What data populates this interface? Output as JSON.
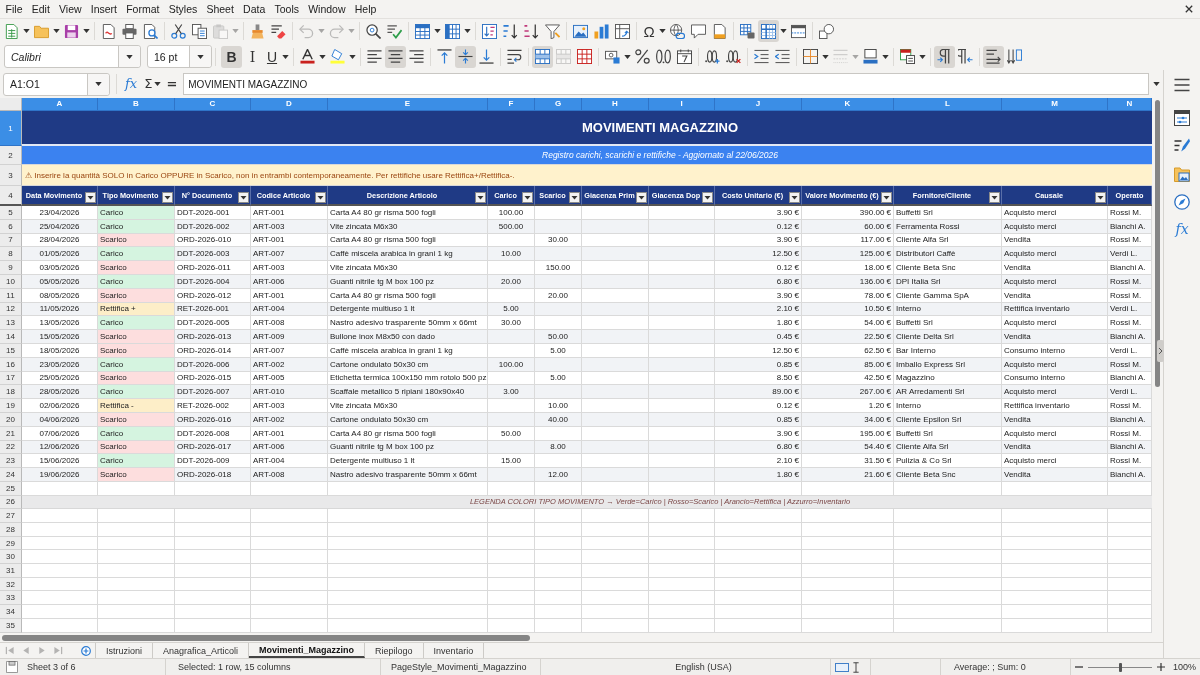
{
  "menu_bar": [
    "File",
    "Edit",
    "View",
    "Insert",
    "Format",
    "Styles",
    "Sheet",
    "Data",
    "Tools",
    "Window",
    "Help"
  ],
  "standard_toolbar": {
    "paste_enabled": false,
    "undo_enabled": false,
    "redo_enabled": false,
    "special_character": "Ω",
    "freeze_rows_and_columns": true
  },
  "formatting_toolbar": {
    "font_name": "Calibri",
    "font_size": "16 pt",
    "bold": {
      "label": "B",
      "on": true
    },
    "italic": {
      "label": "I",
      "on": false
    },
    "underline": {
      "label": "U",
      "on": false
    },
    "align_left": false,
    "align_center": true,
    "align_right": false,
    "align_top": false,
    "align_middle": true,
    "align_bottom": false,
    "wrap_text": false,
    "merge_and_center": true,
    "merge_cells_enabled": false,
    "border_style_enabled": false,
    "left_to_right": true,
    "right_to_left": false,
    "text_horizontal": true,
    "text_vertical": false
  },
  "formula_bar": {
    "name_box": "A1:O1",
    "function_wizard": "fx",
    "sum": "Σ",
    "equals": "=",
    "content": "MOVIMENTI MAGAZZINO"
  },
  "sidebar": {
    "functions": "fx"
  },
  "sheet": {
    "columns": [
      {
        "letter": "A",
        "selected": true
      },
      {
        "letter": "B",
        "selected": true
      },
      {
        "letter": "C",
        "selected": true
      },
      {
        "letter": "D",
        "selected": true
      },
      {
        "letter": "E",
        "selected": true
      },
      {
        "letter": "F",
        "selected": true
      },
      {
        "letter": "G",
        "selected": true
      },
      {
        "letter": "H",
        "selected": true
      },
      {
        "letter": "I",
        "selected": true
      },
      {
        "letter": "J",
        "selected": true
      },
      {
        "letter": "K",
        "selected": true
      },
      {
        "letter": "L",
        "selected": true
      },
      {
        "letter": "M",
        "selected": true
      },
      {
        "letter": "N",
        "selected": true
      }
    ],
    "row_numbers": [
      {
        "number": "1",
        "selected": true
      },
      {
        "number": "2",
        "selected": false
      },
      {
        "number": "3",
        "selected": false
      },
      {
        "number": "4",
        "selected": false
      },
      {
        "number": "5",
        "selected": false
      },
      {
        "number": "6",
        "selected": false
      },
      {
        "number": "7",
        "selected": false
      },
      {
        "number": "8",
        "selected": false
      },
      {
        "number": "9",
        "selected": false
      },
      {
        "number": "10",
        "selected": false
      },
      {
        "number": "11",
        "selected": false
      },
      {
        "number": "12",
        "selected": false
      },
      {
        "number": "13",
        "selected": false
      },
      {
        "number": "14",
        "selected": false
      },
      {
        "number": "15",
        "selected": false
      },
      {
        "number": "16",
        "selected": false
      },
      {
        "number": "17",
        "selected": false
      },
      {
        "number": "18",
        "selected": false
      },
      {
        "number": "19",
        "selected": false
      },
      {
        "number": "20",
        "selected": false
      },
      {
        "number": "21",
        "selected": false
      },
      {
        "number": "22",
        "selected": false
      },
      {
        "number": "23",
        "selected": false
      },
      {
        "number": "24",
        "selected": false
      },
      {
        "number": "25",
        "selected": false
      },
      {
        "number": "26",
        "selected": false
      },
      {
        "number": "27",
        "selected": false
      },
      {
        "number": "28",
        "selected": false
      },
      {
        "number": "29",
        "selected": false
      },
      {
        "number": "30",
        "selected": false
      },
      {
        "number": "31",
        "selected": false
      },
      {
        "number": "32",
        "selected": false
      },
      {
        "number": "33",
        "selected": false
      },
      {
        "number": "34",
        "selected": false
      },
      {
        "number": "35",
        "selected": false
      }
    ],
    "title": "MOVIMENTI MAGAZZINO",
    "subtitle": "Registro carichi, scarichi e rettifiche - Aggiornato al 22/06/2026",
    "notice": "⚠ Inserire la quantità SOLO in Carico OPPURE in Scarico, non in entrambi contemporaneamente. Per rettifiche usare Rettifica+/Rettifica-.",
    "table": {
      "columns": [
        "Data Movimento",
        "Tipo Movimento",
        "N° Documento",
        "Codice Articolo",
        "Descrizione Articolo",
        "Carico",
        "Scarico",
        "Giacenza Prim",
        "Giacenza Dop",
        "Costo Unitario (€)",
        "Valore Movimento (€)",
        "Fornitore/Cliente",
        "Causale",
        "Operato"
      ],
      "rows": [
        {
          "date": "23/04/2026",
          "type": "Carico",
          "color": "#d5f4e0",
          "document": "DDT-2026-001",
          "article_code": "ART-001",
          "description": "Carta A4 80 gr risma 500 fogli",
          "load": "100.00",
          "unit_cost": "3.90 €",
          "value": "390.00 €",
          "party": "Buffetti Srl",
          "reason": "Acquisto merci",
          "operator": "Rossi M."
        },
        {
          "date": "25/04/2026",
          "type": "Carico",
          "color": "#d5f4e0",
          "document": "DDT-2026-002",
          "article_code": "ART-003",
          "description": "Vite zincata M6x30",
          "load": "500.00",
          "unit_cost": "0.12 €",
          "value": "60.00 €",
          "party": "Ferramenta Rossi",
          "reason": "Acquisto merci",
          "operator": "Bianchi A."
        },
        {
          "date": "28/04/2026",
          "type": "Scarico",
          "color": "#fddede",
          "document": "ORD-2026-010",
          "article_code": "ART-001",
          "description": "Carta A4 80 gr risma 500 fogli",
          "unload": "30.00",
          "unit_cost": "3.90 €",
          "value": "117.00 €",
          "party": "Cliente Alfa Srl",
          "reason": "Vendita",
          "operator": "Rossi M."
        },
        {
          "date": "01/05/2026",
          "type": "Carico",
          "color": "#d5f4e0",
          "document": "DDT-2026-003",
          "article_code": "ART-007",
          "description": "Caffè miscela arabica in grani 1 kg",
          "load": "10.00",
          "unit_cost": "12.50 €",
          "value": "125.00 €",
          "party": "Distributori Caffè",
          "reason": "Acquisto merci",
          "operator": "Verdi L."
        },
        {
          "date": "03/05/2026",
          "type": "Scarico",
          "color": "#fddede",
          "document": "ORD-2026-011",
          "article_code": "ART-003",
          "description": "Vite zincata M6x30",
          "unload": "150.00",
          "unit_cost": "0.12 €",
          "value": "18.00 €",
          "party": "Cliente Beta Snc",
          "reason": "Vendita",
          "operator": "Bianchi A."
        },
        {
          "date": "05/05/2026",
          "type": "Carico",
          "color": "#d5f4e0",
          "document": "DDT-2026-004",
          "article_code": "ART-006",
          "description": "Guanti nitrile tg M box 100 pz",
          "load": "20.00",
          "unit_cost": "6.80 €",
          "value": "136.00 €",
          "party": "DPI Italia Srl",
          "reason": "Acquisto merci",
          "operator": "Rossi M."
        },
        {
          "date": "08/05/2026",
          "type": "Scarico",
          "color": "#fddede",
          "document": "ORD-2026-012",
          "article_code": "ART-001",
          "description": "Carta A4 80 gr risma 500 fogli",
          "unload": "20.00",
          "unit_cost": "3.90 €",
          "value": "78.00 €",
          "party": "Cliente Gamma SpA",
          "reason": "Vendita",
          "operator": "Rossi M."
        },
        {
          "date": "11/05/2026",
          "type": "Rettifica +",
          "color": "#fdeec8",
          "document": "RET-2026-001",
          "article_code": "ART-004",
          "description": "Detergente multiuso 1 lt",
          "load": "5.00",
          "unit_cost": "2.10 €",
          "value": "10.50 €",
          "party": "Interno",
          "reason": "Rettifica inventario",
          "operator": "Verdi L."
        },
        {
          "date": "13/05/2026",
          "type": "Carico",
          "color": "#d5f4e0",
          "document": "DDT-2026-005",
          "article_code": "ART-008",
          "description": "Nastro adesivo trasparente 50mm x 66mt",
          "load": "30.00",
          "unit_cost": "1.80 €",
          "value": "54.00 €",
          "party": "Buffetti Srl",
          "reason": "Acquisto merci",
          "operator": "Rossi M."
        },
        {
          "date": "15/05/2026",
          "type": "Scarico",
          "color": "#fddede",
          "document": "ORD-2026-013",
          "article_code": "ART-009",
          "description": "Bullone inox M8x50 con dado",
          "unload": "50.00",
          "unit_cost": "0.45 €",
          "value": "22.50 €",
          "party": "Cliente Delta Srl",
          "reason": "Vendita",
          "operator": "Bianchi A."
        },
        {
          "date": "18/05/2026",
          "type": "Scarico",
          "color": "#fddede",
          "document": "ORD-2026-014",
          "article_code": "ART-007",
          "description": "Caffè miscela arabica in grani 1 kg",
          "unload": "5.00",
          "unit_cost": "12.50 €",
          "value": "62.50 €",
          "party": "Bar Interno",
          "reason": "Consumo interno",
          "operator": "Verdi L."
        },
        {
          "date": "23/05/2026",
          "type": "Carico",
          "color": "#d5f4e0",
          "document": "DDT-2026-006",
          "article_code": "ART-002",
          "description": "Cartone ondulato 50x30 cm",
          "load": "100.00",
          "unit_cost": "0.85 €",
          "value": "85.00 €",
          "party": "Imballo Express Srl",
          "reason": "Acquisto merci",
          "operator": "Rossi M."
        },
        {
          "date": "25/05/2026",
          "type": "Scarico",
          "color": "#fddede",
          "document": "ORD-2026-015",
          "article_code": "ART-005",
          "description": "Etichetta termica 100x150 mm rotolo 500 pz",
          "unload": "5.00",
          "unit_cost": "8.50 €",
          "value": "42.50 €",
          "party": "Magazzino",
          "reason": "Consumo interno",
          "operator": "Bianchi A."
        },
        {
          "date": "28/05/2026",
          "type": "Carico",
          "color": "#d5f4e0",
          "document": "DDT-2026-007",
          "article_code": "ART-010",
          "description": "Scaffale metallico 5 ripiani 180x90x40",
          "load": "3.00",
          "unit_cost": "89.00 €",
          "value": "267.00 €",
          "party": "AR Arredamenti Srl",
          "reason": "Acquisto merci",
          "operator": "Verdi L."
        },
        {
          "date": "02/06/2026",
          "type": "Rettifica -",
          "color": "#fdeec8",
          "document": "RET-2026-002",
          "article_code": "ART-003",
          "description": "Vite zincata M6x30",
          "unload": "10.00",
          "unit_cost": "0.12 €",
          "value": "1.20 €",
          "party": "Interno",
          "reason": "Rettifica inventario",
          "operator": "Rossi M."
        },
        {
          "date": "04/06/2026",
          "type": "Scarico",
          "color": "#fddede",
          "document": "ORD-2026-016",
          "article_code": "ART-002",
          "description": "Cartone ondulato 50x30 cm",
          "unload": "40.00",
          "unit_cost": "0.85 €",
          "value": "34.00 €",
          "party": "Cliente Epsilon Srl",
          "reason": "Vendita",
          "operator": "Bianchi A."
        },
        {
          "date": "07/06/2026",
          "type": "Carico",
          "color": "#d5f4e0",
          "document": "DDT-2026-008",
          "article_code": "ART-001",
          "description": "Carta A4 80 gr risma 500 fogli",
          "load": "50.00",
          "unit_cost": "3.90 €",
          "value": "195.00 €",
          "party": "Buffetti Srl",
          "reason": "Acquisto merci",
          "operator": "Rossi M."
        },
        {
          "date": "12/06/2026",
          "type": "Scarico",
          "color": "#fddede",
          "document": "ORD-2026-017",
          "article_code": "ART-006",
          "description": "Guanti nitrile tg M box 100 pz",
          "unload": "8.00",
          "unit_cost": "6.80 €",
          "value": "54.40 €",
          "party": "Cliente Alfa Srl",
          "reason": "Vendita",
          "operator": "Bianchi A."
        },
        {
          "date": "15/06/2026",
          "type": "Carico",
          "color": "#d5f4e0",
          "document": "DDT-2026-009",
          "article_code": "ART-004",
          "description": "Detergente multiuso 1 lt",
          "load": "15.00",
          "unit_cost": "2.10 €",
          "value": "31.50 €",
          "party": "Pulizia & Co Srl",
          "reason": "Acquisto merci",
          "operator": "Rossi M."
        },
        {
          "date": "19/06/2026",
          "type": "Scarico",
          "color": "#fddede",
          "document": "ORD-2026-018",
          "article_code": "ART-008",
          "description": "Nastro adesivo trasparente 50mm x 66mt",
          "unload": "12.00",
          "unit_cost": "1.80 €",
          "value": "21.60 €",
          "party": "Cliente Beta Snc",
          "reason": "Vendita",
          "operator": "Bianchi A."
        }
      ]
    },
    "legend": "LEGENDA COLORI TIPO MOVIMENTO → Verde=Carico | Rosso=Scarico | Arancio=Rettifica | Azzurro=Inventario"
  },
  "sheet_tabs": [
    {
      "label": "Istruzioni",
      "selected": false
    },
    {
      "label": "Anagrafica_Articoli",
      "selected": false
    },
    {
      "label": "Movimenti_Magazzino",
      "selected": true
    },
    {
      "label": "Riepilogo",
      "selected": false
    },
    {
      "label": "Inventario",
      "selected": false
    }
  ],
  "status_bar": {
    "sheet_position": "Sheet 3 of 6",
    "selection": "Selected: 1 row, 15 columns",
    "page_style": "PageStyle_Movimenti_Magazzino",
    "language": "English (USA)",
    "summary": "Average: ; Sum: 0",
    "zoom": {
      "level": 0.5,
      "label": "100%"
    }
  }
}
